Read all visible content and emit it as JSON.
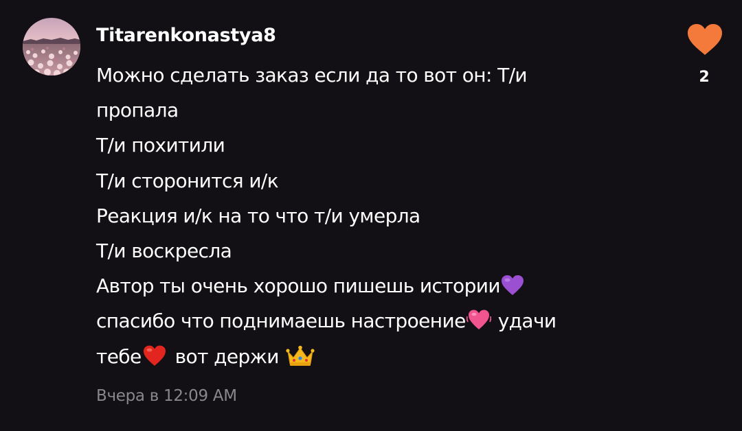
{
  "comment": {
    "username": "Titarenkonastya8",
    "lines": [
      "Можно сделать заказ если  да то вот он: Т/и",
      "пропала",
      "Т/и похитили",
      "Т/и сторонится и/к",
      "Реакция и/к на то что т/и умерла",
      "Т/и воскресла",
      "Автор ты очень хорошо пишешь истории",
      "спасибо что поднимаешь настроение",
      "удачи",
      "тебе",
      "вот держи"
    ],
    "emojis": [
      "purple-heart",
      "beating-heart",
      "red-heart",
      "crown"
    ],
    "timestamp": "Вчера в 12:09 AM",
    "likes": "2",
    "icons": {
      "like": "heart-icon"
    },
    "colors": {
      "background": "#121014",
      "like_heart": "#f47a3c",
      "timestamp": "#8a878c"
    }
  }
}
